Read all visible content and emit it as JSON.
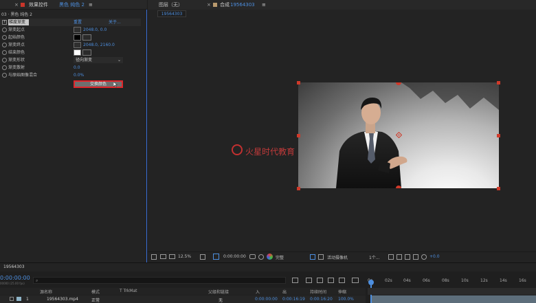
{
  "effects_panel": {
    "close_mark": "×",
    "tab_label": "效果控件",
    "tab_layer": "黑色 纯色 2",
    "menu_glyph": "≡",
    "breadcrumb": "03 · 黑色 纯色 2",
    "fx_name": "梯度渐变",
    "reset_label": "重置",
    "about_label": "关于...",
    "properties": [
      {
        "label": "渐变起点",
        "value": "2048.0, 0.0"
      },
      {
        "label": "起始颜色",
        "value": ""
      },
      {
        "label": "渐变终点",
        "value": "2048.0, 2160.0"
      },
      {
        "label": "结束颜色",
        "value": ""
      },
      {
        "label": "渐变形状",
        "value": "径向渐变"
      },
      {
        "label": "渐变散射",
        "value": "0.0"
      },
      {
        "label": "与原始图像混合",
        "value": "0.0%"
      }
    ],
    "swap_button": "交换颜色",
    "start_color": "#000000",
    "end_color": "#ffffff"
  },
  "comp_panel": {
    "layer_tab": "图层（无）",
    "comp_tab_prefix": "合成",
    "comp_name": "19564303",
    "subtab": "19564303",
    "watermark": "火星时代教育"
  },
  "viewer_toolbar": {
    "zoom": "12.5%",
    "timecode": "0:00:00:00",
    "resolution": "完整",
    "camera": "活动摄像机",
    "views": "1个...",
    "exposure": "+0.0"
  },
  "timeline": {
    "comp_tab": "19564303",
    "timecode": "0:00:00:00",
    "fps": "00000 (25.00 fps)",
    "search_placeholder": "",
    "columns": {
      "source": "源名称",
      "mode": "模式",
      "trk": "T  TrkMat",
      "parent": "父级和链接",
      "in": "入",
      "out": "出",
      "duration": "持续时间",
      "stretch": "伸缩"
    },
    "layer": {
      "index": "1",
      "name": "19564303.mp4",
      "mode": "正常",
      "parent": "无",
      "in": "0:00:00:00",
      "out": "0:00:16:19",
      "duration": "0:00:16:20",
      "stretch": "100.0%"
    },
    "ruler": [
      "0s",
      "02s",
      "04s",
      "06s",
      "08s",
      "10s",
      "12s",
      "14s",
      "16s"
    ]
  }
}
